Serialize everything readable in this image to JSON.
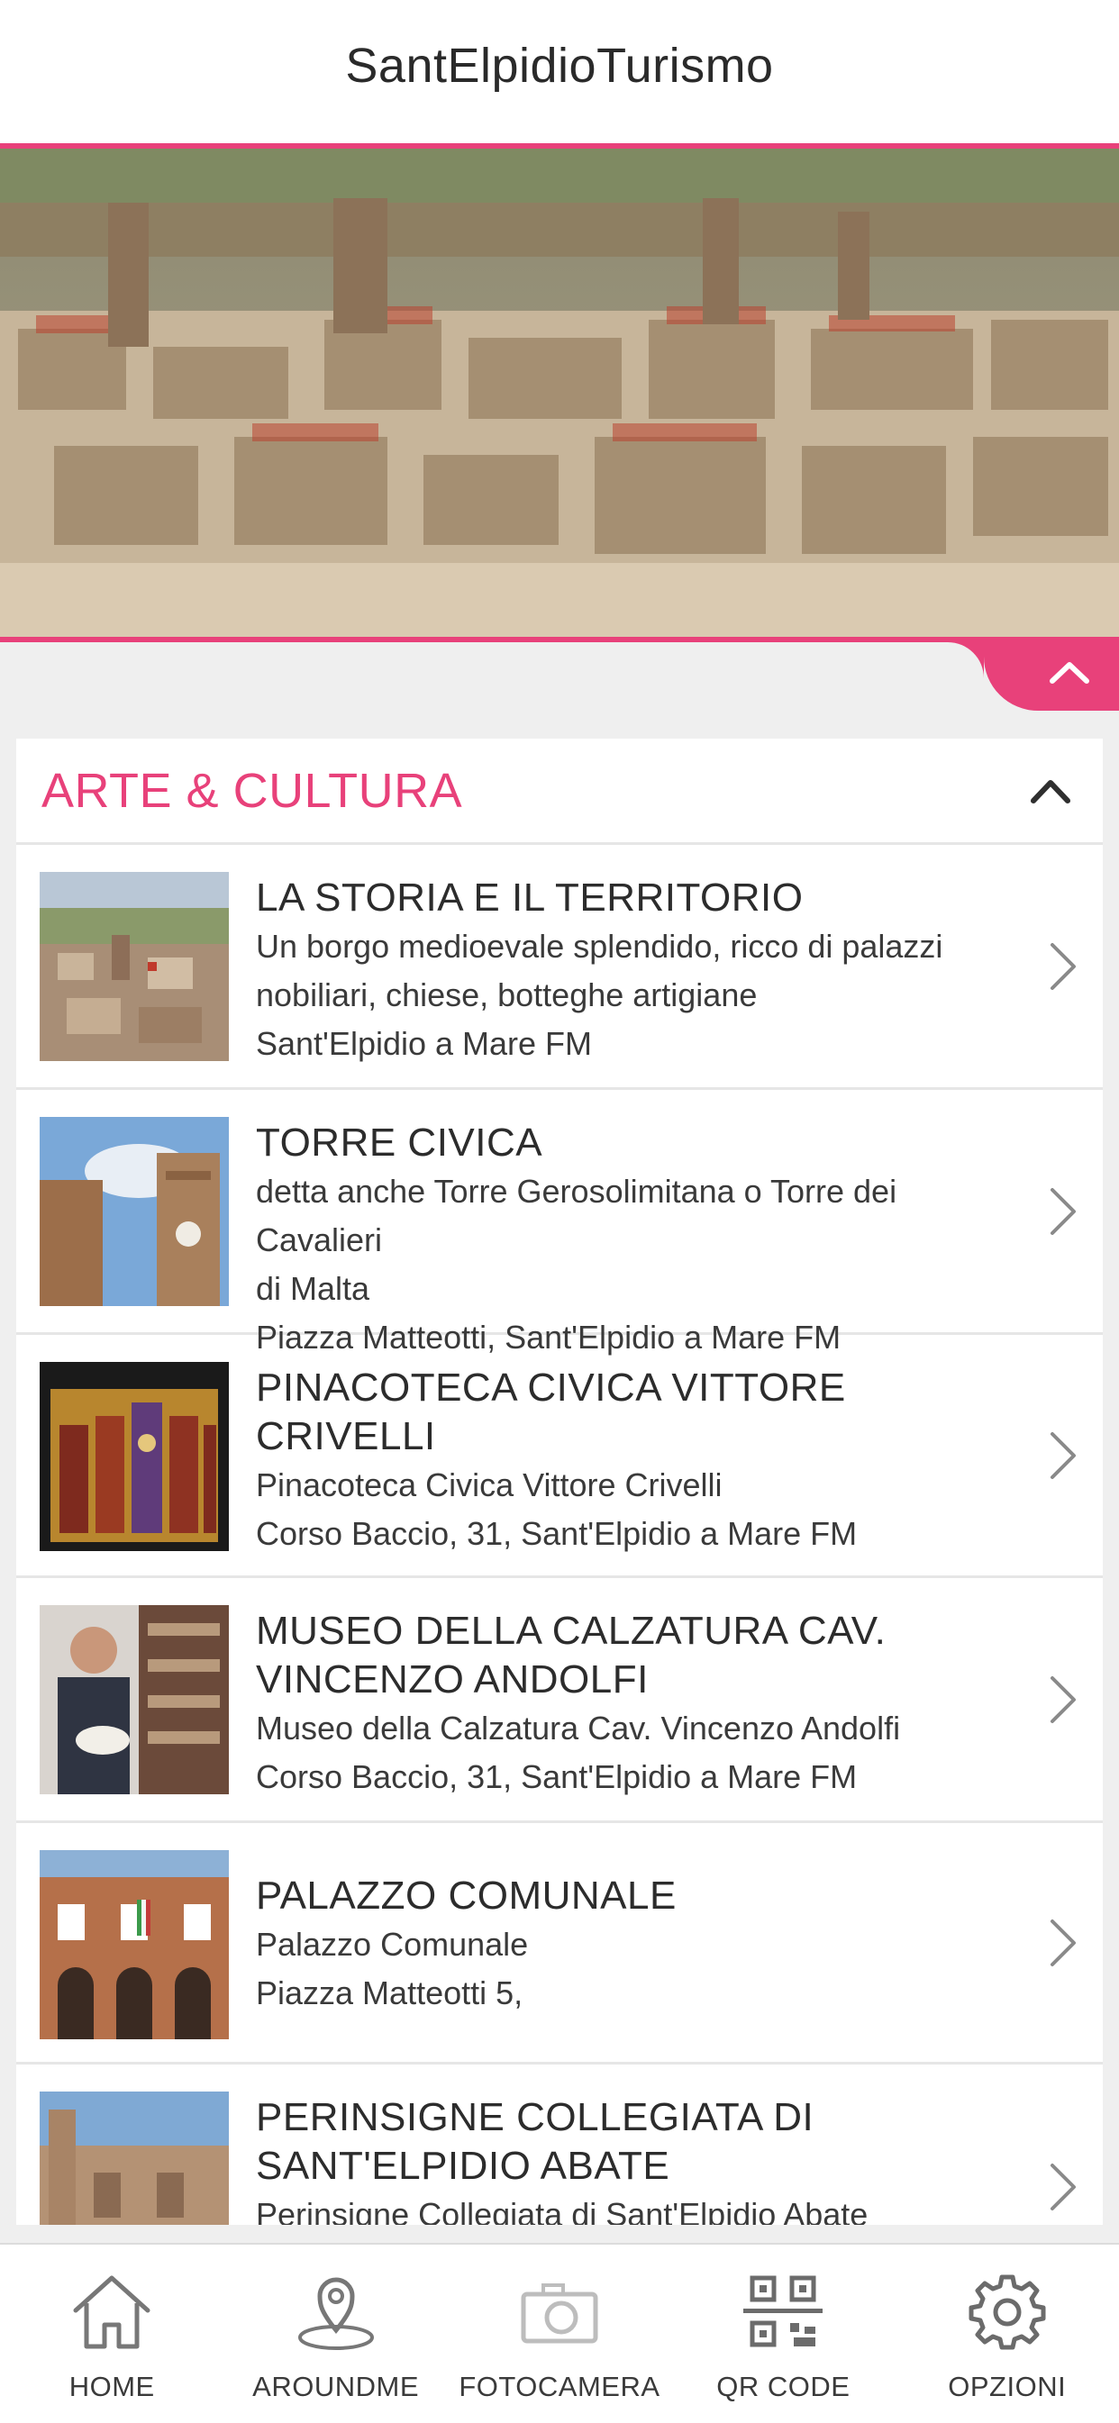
{
  "header": {
    "title": "SantElpidioTurismo"
  },
  "section": {
    "title": "ARTE & CULTURA"
  },
  "items": [
    {
      "title": "LA STORIA E IL TERRITORIO",
      "lines": [
        "Un borgo medioevale splendido, ricco di palazzi",
        "nobiliari, chiese, botteghe artigiane",
        "Sant'Elpidio a Mare FM"
      ]
    },
    {
      "title": "TORRE CIVICA",
      "lines": [
        "detta anche Torre Gerosolimitana o Torre dei Cavalieri",
        "di Malta",
        "Piazza Matteotti, Sant'Elpidio a Mare FM"
      ]
    },
    {
      "title": "PINACOTECA CIVICA VITTORE CRIVELLI",
      "lines": [
        "Pinacoteca Civica Vittore Crivelli",
        "Corso Baccio, 31, Sant'Elpidio a Mare FM"
      ]
    },
    {
      "title": "MUSEO DELLA CALZATURA CAV. VINCENZO ANDOLFI",
      "lines": [
        "Museo della Calzatura Cav. Vincenzo Andolfi",
        "Corso Baccio, 31, Sant'Elpidio a Mare FM"
      ]
    },
    {
      "title": "PALAZZO COMUNALE",
      "lines": [
        "Palazzo Comunale",
        "Piazza Matteotti 5,"
      ]
    },
    {
      "title": "PERINSIGNE COLLEGIATA DI SANT'ELPIDIO ABATE",
      "lines": [
        "Perinsigne Collegiata di Sant'Elpidio Abate"
      ]
    }
  ],
  "nav": [
    {
      "label": "HOME",
      "icon": "home-icon"
    },
    {
      "label": "AROUNDME",
      "icon": "location-pin-icon"
    },
    {
      "label": "FOTOCAMERA",
      "icon": "camera-icon"
    },
    {
      "label": "QR CODE",
      "icon": "qr-code-icon"
    },
    {
      "label": "OPZIONI",
      "icon": "gear-icon"
    }
  ],
  "colors": {
    "accent": "#e8417a",
    "background": "#efefef",
    "text": "#2f2f2f"
  }
}
